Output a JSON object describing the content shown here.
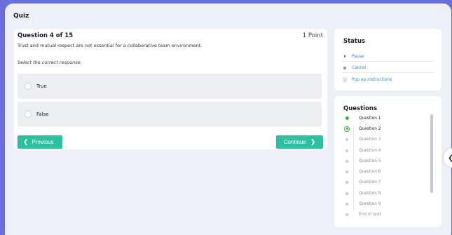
{
  "app": {
    "title": "Quiz"
  },
  "quiz": {
    "header": "Question 4 of 15",
    "points": "1 Point",
    "question": "Trust and mutual respect are not essential for a collaborative team environment.",
    "instruction": "Select the correct response:",
    "options": [
      {
        "label": "True"
      },
      {
        "label": "False"
      }
    ],
    "prev_label": "Previous",
    "next_label": "Continue",
    "prev_icon": "chevron-left-icon",
    "next_icon": "chevron-right-icon"
  },
  "status": {
    "title": "Status",
    "items": [
      {
        "label": "Pause",
        "icon": "pause-icon"
      },
      {
        "label": "Cancel",
        "icon": "cancel-icon"
      },
      {
        "label": "Pop up instructions",
        "icon": "info-icon"
      }
    ]
  },
  "questions": {
    "title": "Questions",
    "items": [
      {
        "label": "Question 1",
        "state": "done"
      },
      {
        "label": "Question 2",
        "state": "current"
      },
      {
        "label": "Question 3",
        "state": "pending"
      },
      {
        "label": "Question 4",
        "state": "pending"
      },
      {
        "label": "Question 5",
        "state": "pending"
      },
      {
        "label": "Question 6",
        "state": "pending"
      },
      {
        "label": "Question 7",
        "state": "pending"
      },
      {
        "label": "Question 8",
        "state": "pending"
      },
      {
        "label": "Question 9",
        "state": "pending"
      },
      {
        "label": "End of quiz",
        "state": "pending"
      }
    ]
  },
  "colors": {
    "accent": "#2bc0a0",
    "link": "#2e7fd6",
    "progress": "#3fae3a",
    "background": "#6b6fd9"
  }
}
